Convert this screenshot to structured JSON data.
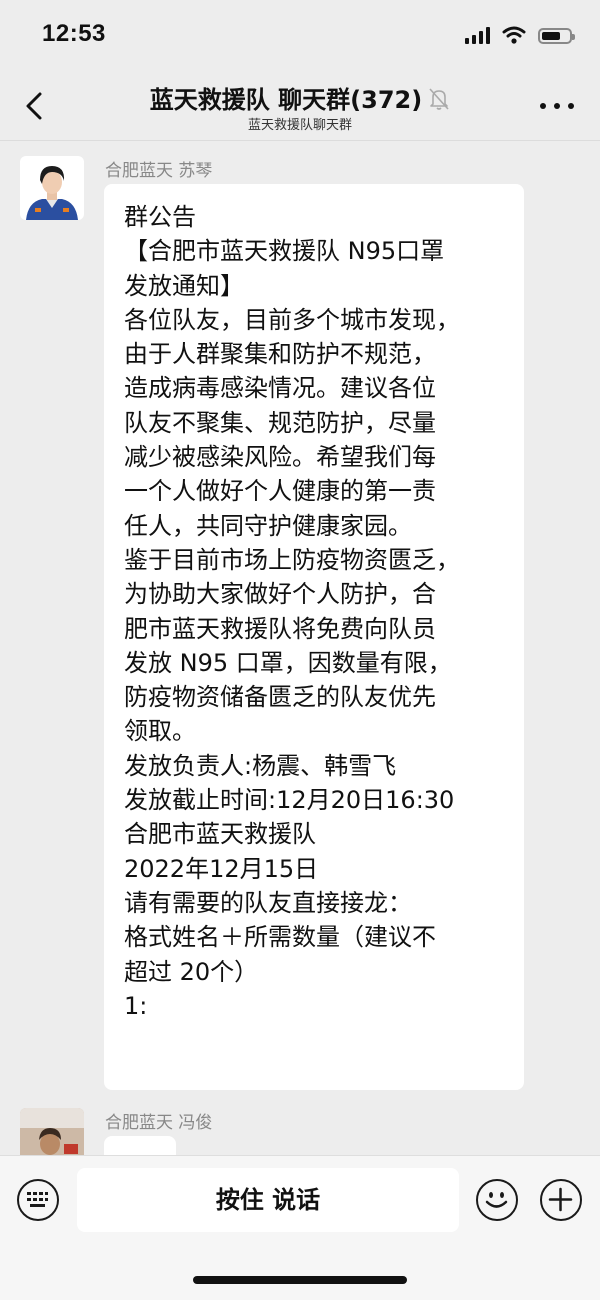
{
  "status_bar": {
    "time": "12:53",
    "icons": [
      "signal-icon",
      "wifi-icon",
      "battery-icon"
    ]
  },
  "nav": {
    "title": "蓝天救援队 聊天群(372)",
    "subtitle": "蓝天救援队聊天群",
    "icons": [
      "back-icon",
      "mute-bell-icon",
      "more-icon"
    ]
  },
  "messages": [
    {
      "sender": "合肥蓝天 苏琴",
      "lines": [
        "群公告",
        "【合肥市蓝天救援队 N95口罩",
        "发放通知】",
        "各位队友，目前多个城市发现，",
        "由于人群聚集和防护不规范，",
        "造成病毒感染情况。建议各位",
        "队友不聚集、规范防护，尽量",
        "减少被感染风险。希望我们每",
        "一个人做好个人健康的第一责",
        "任人，共同守护健康家园。",
        "鉴于目前市场上防疫物资匮乏，",
        "为协助大家做好个人防护，合",
        "肥市蓝天救援队将免费向队员",
        "发放 N95 口罩，因数量有限，",
        "防疫物资储备匮乏的队友优先",
        "领取。",
        "发放负责人:杨震、韩雪飞",
        "发放截止时间:12月20日16:30",
        "合肥市蓝天救援队",
        "2022年12月15日",
        "请有需要的队友直接接龙：",
        "格式姓名＋所需数量（建议不",
        "超过 20个）",
        "1:"
      ]
    },
    {
      "sender": "合肥蓝天 冯俊",
      "lines": []
    }
  ],
  "input_bar": {
    "voice_label": "按住 说话",
    "icons": [
      "keyboard-icon",
      "emoji-icon",
      "plus-icon"
    ]
  },
  "colors": {
    "background": "#ededed",
    "bubble": "#ffffff",
    "sender_name": "#888888"
  }
}
